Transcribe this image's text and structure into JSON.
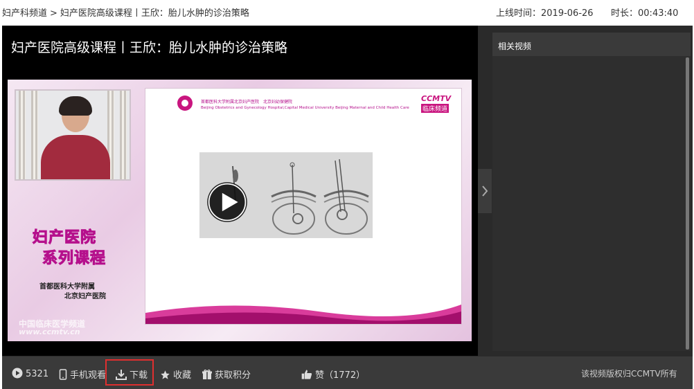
{
  "breadcrumb": {
    "items": [
      "妇产科频道",
      "妇产医院高级课程丨王欣：胎儿水肿的诊治策略"
    ],
    "separator": ">"
  },
  "meta": {
    "upload_label": "上线时间：",
    "upload_date": "2019-06-26",
    "duration_label": "时长：",
    "duration": "00:43:40"
  },
  "video": {
    "title": "妇产医院高级课程丨王欣：胎儿水肿的诊治策略"
  },
  "slide": {
    "series_title_1": "妇产医院",
    "series_title_2": "系列课程",
    "institution_1": "首都医科大学附属",
    "institution_2": "北京妇产医院",
    "watermark_cn": "中国临床医学频道",
    "watermark_url": "www.ccmtv.cn",
    "hospital_cn": "首都医科大学附属北京妇产医院　北京妇幼保健院",
    "hospital_en": "Beijing Obstetrics and Gynecology Hospital,Capital Medical University  Beijing Maternal and Child Health Care",
    "brand": "CCMTV",
    "brand_sub": "临床频道"
  },
  "sidebar": {
    "title": "相关视频"
  },
  "actions": {
    "views": "5321",
    "mobile": "手机观看",
    "download": "下载",
    "favorite": "收藏",
    "points": "获取积分",
    "like": "赞（1772）",
    "copyright": "该视频版权归CCMTV所有"
  },
  "colors": {
    "accent_magenta": "#c9157f",
    "highlight_red": "#e02f2f",
    "bar_bg": "#3a3a3a"
  },
  "icons": [
    "play-circle-icon",
    "mobile-icon",
    "download-icon",
    "star-icon",
    "gift-icon",
    "thumbs-up-icon",
    "chevron-right-icon",
    "play-icon"
  ]
}
